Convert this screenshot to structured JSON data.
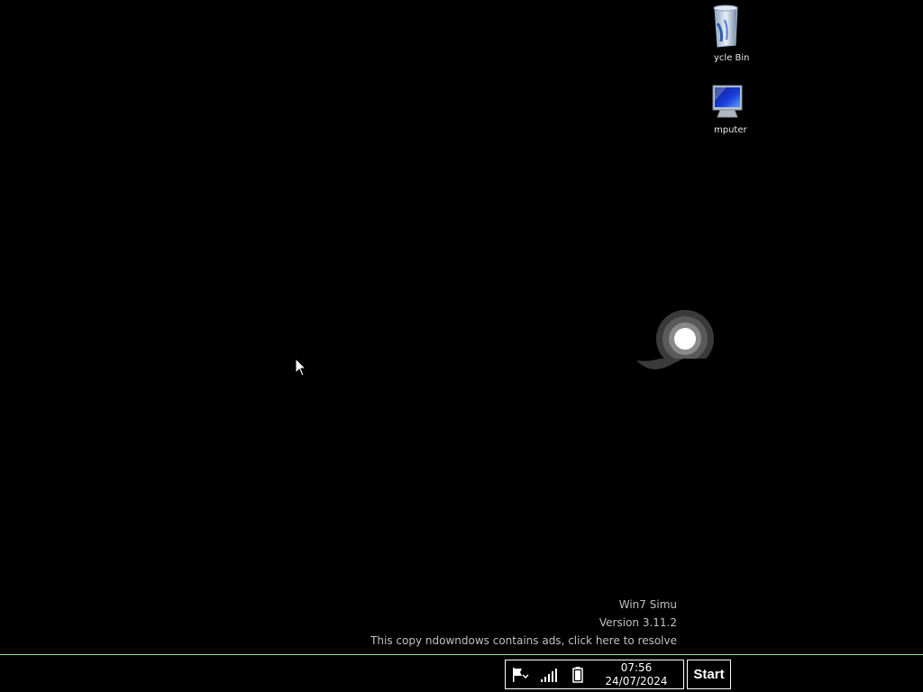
{
  "desktop": {
    "icons": [
      {
        "label": "ycle Bin",
        "icon": "recycle-bin-icon"
      },
      {
        "label": "mputer",
        "icon": "computer-icon"
      }
    ]
  },
  "watermark": {
    "line1": "Win7 Simu",
    "line2": "Version 3.11.2",
    "line3": "This copy ndowndows contains ads, click here to resolve"
  },
  "taskbar": {
    "clock_time": "07:56",
    "clock_date": "24/07/2024",
    "start_label": "Start",
    "tray_icons": [
      "flag-icon",
      "signal-bars-icon",
      "battery-icon"
    ]
  },
  "colors": {
    "background": "#000000",
    "taskbar_border": "#9be39b",
    "text": "#c0c0c0"
  }
}
